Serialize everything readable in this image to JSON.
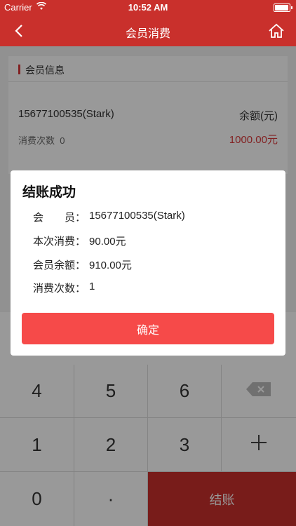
{
  "status_bar": {
    "carrier": "Carrier",
    "time": "10:52 AM",
    "wifi_icon": "wifi-icon",
    "battery_icon": "battery-icon"
  },
  "nav": {
    "title": "会员消费",
    "back_icon": "chevron-left-icon",
    "home_icon": "home-icon"
  },
  "member_card": {
    "section_title": "会员信息",
    "member": "15677100535(Stark)",
    "balance_label": "余额(元)",
    "visits_label": "消费次数",
    "visits_value": "0",
    "balance_value": "1000.00元"
  },
  "keypad": {
    "keys": [
      "4",
      "5",
      "6",
      "1",
      "2",
      "3",
      "0",
      "·"
    ],
    "backspace_icon": "backspace-icon",
    "plus_icon": "plus-icon",
    "pay_label": "结账"
  },
  "dialog": {
    "title": "结账成功",
    "rows": [
      {
        "label": "会　　员：",
        "value": "15677100535(Stark)"
      },
      {
        "label": "本次消费：",
        "value": "90.00元"
      },
      {
        "label": "会员余额：",
        "value": "910.00元"
      },
      {
        "label": "消费次数：",
        "value": "1"
      }
    ],
    "confirm_label": "确定"
  },
  "colors": {
    "brand": "#c9302c",
    "button": "#f64a49",
    "accent_text": "#d9383a"
  }
}
